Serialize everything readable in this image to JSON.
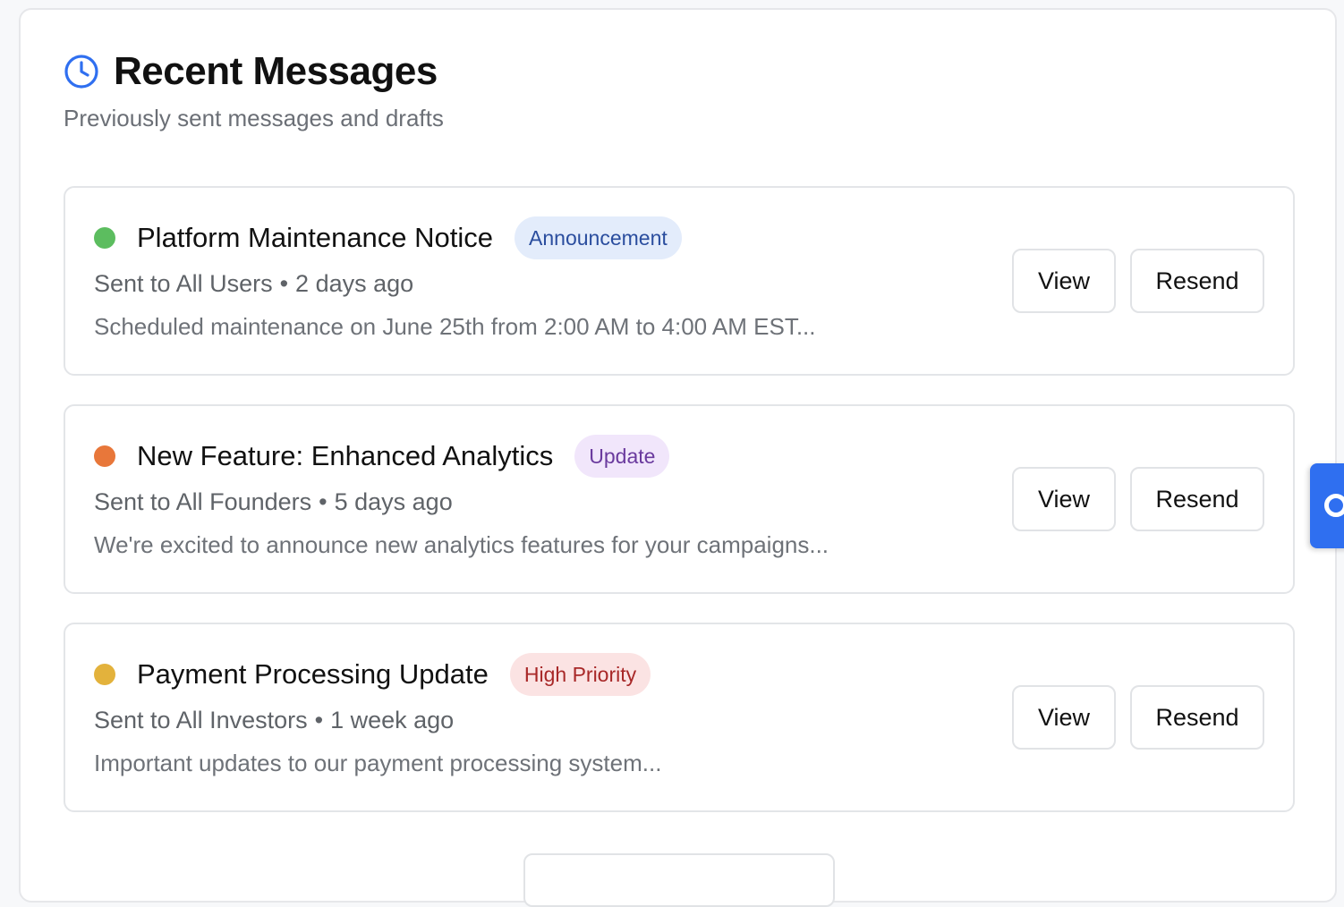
{
  "header": {
    "icon": "clock-icon",
    "title": "Recent Messages",
    "subtitle": "Previously sent messages and drafts"
  },
  "messages": [
    {
      "title": "Platform Maintenance Notice",
      "status_color": "#5cbd5f",
      "badge": {
        "label": "Announcement",
        "bg": "#e3ecfb",
        "fg": "#2a4d9e"
      },
      "recipients": "Sent to All Users",
      "separator": "•",
      "time": "2 days ago",
      "preview": "Scheduled maintenance on June 25th from 2:00 AM to 4:00 AM EST...",
      "view_label": "View",
      "resend_label": "Resend"
    },
    {
      "title": "New Feature: Enhanced Analytics",
      "status_color": "#e8773a",
      "badge": {
        "label": "Update",
        "bg": "#f1e6fb",
        "fg": "#6a3a9e"
      },
      "recipients": "Sent to All Founders",
      "separator": "•",
      "time": "5 days ago",
      "preview": "We're excited to announce new analytics features for your campaigns...",
      "view_label": "View",
      "resend_label": "Resend"
    },
    {
      "title": "Payment Processing Update",
      "status_color": "#e3b23c",
      "badge": {
        "label": "High Priority",
        "bg": "#fbe3e3",
        "fg": "#a82828"
      },
      "recipients": "Sent to All Investors",
      "separator": "•",
      "time": "1 week ago",
      "preview": "Important updates to our payment processing system...",
      "view_label": "View",
      "resend_label": "Resend"
    }
  ],
  "colors": {
    "accent": "#2f6ff0",
    "border": "#e3e5e8"
  }
}
